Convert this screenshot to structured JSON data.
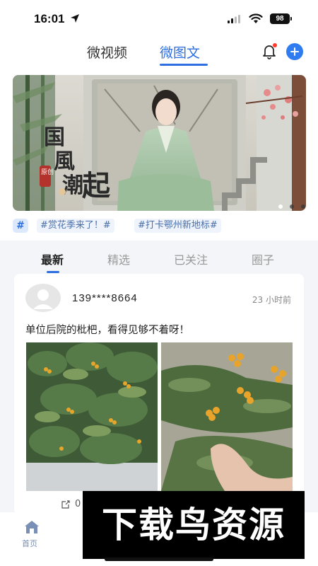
{
  "status_bar": {
    "time": "16:01",
    "battery": "98",
    "icons": [
      "location-arrow-icon",
      "signal-icon",
      "wifi-icon",
      "battery-icon"
    ]
  },
  "header": {
    "tabs": [
      {
        "label": "微视频"
      },
      {
        "label": "微图文"
      }
    ],
    "active_tab": 1,
    "accent": "#2d6fe0",
    "icons": [
      "bell-icon",
      "plus-circle-icon"
    ]
  },
  "banner": {
    "title_chars": [
      "国",
      "風",
      "潮",
      "起"
    ],
    "stamp": "原创",
    "page_count": 3,
    "active_page": 0
  },
  "hashtags": {
    "badge": "#",
    "items": [
      "#赏花季来了！#",
      "#打卡鄂州新地标#"
    ]
  },
  "feed_tabs": {
    "items": [
      "最新",
      "精选",
      "已关注",
      "圈子"
    ],
    "active": 0
  },
  "post": {
    "username": "139****8664",
    "time": "23 小时前",
    "text": "单位后院的枇杷，看得见够不着呀！",
    "share_count": "0"
  },
  "bottom_nav": {
    "home_label": "首页"
  },
  "watermark": "下载鸟资源"
}
